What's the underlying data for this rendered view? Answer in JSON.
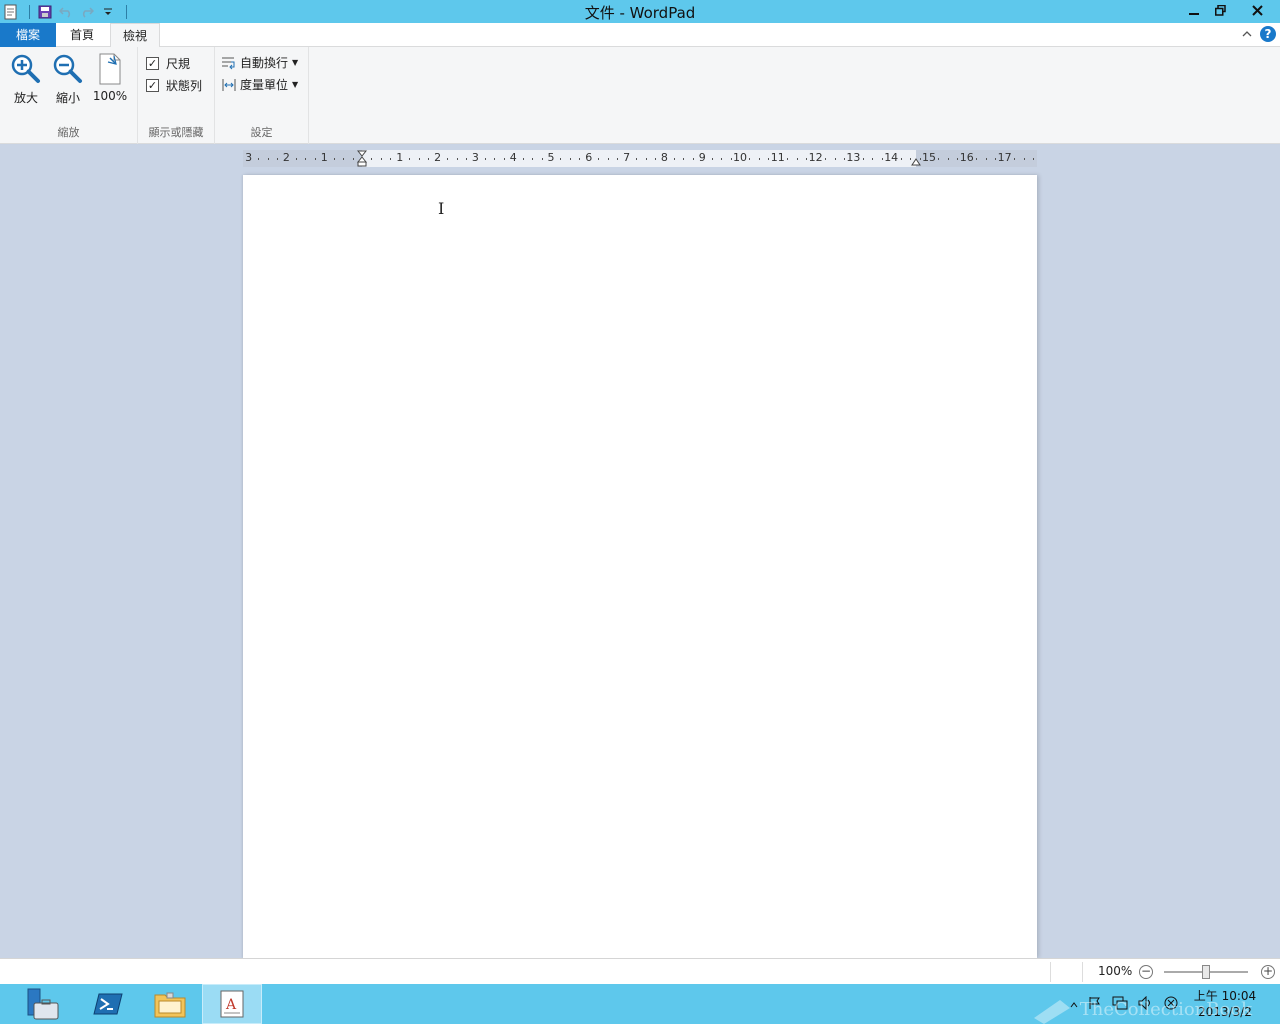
{
  "window": {
    "title": "文件 - WordPad",
    "minimize_label": "▁",
    "restore_label": "❐",
    "close_label": "✕"
  },
  "ribbon_tabs": {
    "file": "檔案",
    "home": "首頁",
    "view": "檢視",
    "active": "檢視"
  },
  "ribbon": {
    "zoom_group": {
      "label": "縮放",
      "zoom_in": "放大",
      "zoom_out": "縮小",
      "hundred": "100%"
    },
    "show_hide_group": {
      "label": "顯示或隱藏",
      "ruler": "尺規",
      "ruler_checked": true,
      "statusbar": "狀態列",
      "statusbar_checked": true
    },
    "settings_group": {
      "label": "設定",
      "word_wrap": "自動換行",
      "measurement_units": "度量單位"
    },
    "help_label": "?"
  },
  "ruler": {
    "left_labels": [
      "3",
      "2",
      "1"
    ],
    "right_labels": [
      "1",
      "2",
      "3",
      "4",
      "5",
      "6",
      "7",
      "8",
      "9",
      "10",
      "11",
      "12",
      "13",
      "14",
      "15",
      "16",
      "17"
    ]
  },
  "statusbar": {
    "zoom_percent": "100%",
    "zoom_out_symbol": "−",
    "zoom_in_symbol": "+",
    "zoom_level": 0.5
  },
  "taskbar": {
    "items": [
      "server-manager",
      "powershell",
      "file-explorer",
      "wordpad"
    ],
    "active": "wordpad"
  },
  "clock": {
    "time": "上午 10:04",
    "date": "2013/3/2"
  },
  "watermark": "TheCollectionBook",
  "colors": {
    "titlebar": "#5ec8ec",
    "file_tab": "#1979ca",
    "workspace": "#c9d4e5",
    "taskbar": "#5ec8ec"
  }
}
